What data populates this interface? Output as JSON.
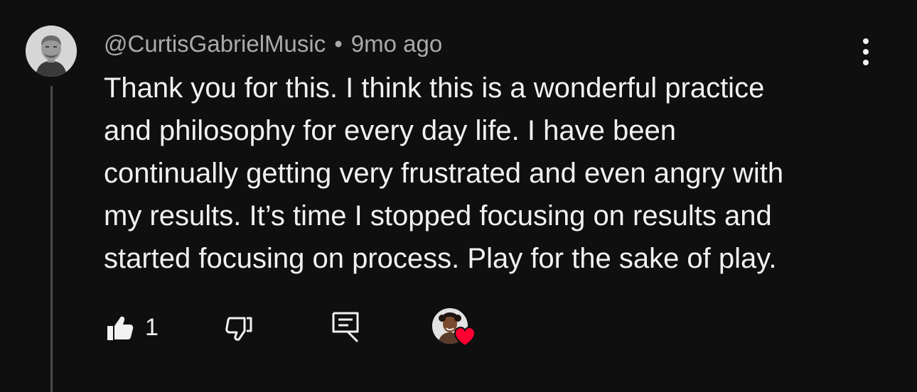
{
  "comment": {
    "author": "@CurtisGabrielMusic",
    "separator": "•",
    "timestamp": "9mo ago",
    "text": "Thank you for this. I think this is a wonderful practice\nand philosophy for every day life. I have been\ncontinually getting very frustrated and even angry with\nmy results. It’s time I stopped focusing on results and\nstarted focusing on process. Play for the sake of play.",
    "like_count": "1"
  },
  "icons": {
    "menu": "more-vertical-icon",
    "like": "thumbs-up-icon",
    "dislike": "thumbs-down-icon",
    "reply": "reply-comment-icon",
    "heart": "heart-icon"
  },
  "colors": {
    "background": "#0f0f0f",
    "text_primary": "#f1f1f1",
    "text_secondary": "#aaaaaa",
    "thread_line": "#4a4a4a",
    "heart": "#ff0033"
  }
}
